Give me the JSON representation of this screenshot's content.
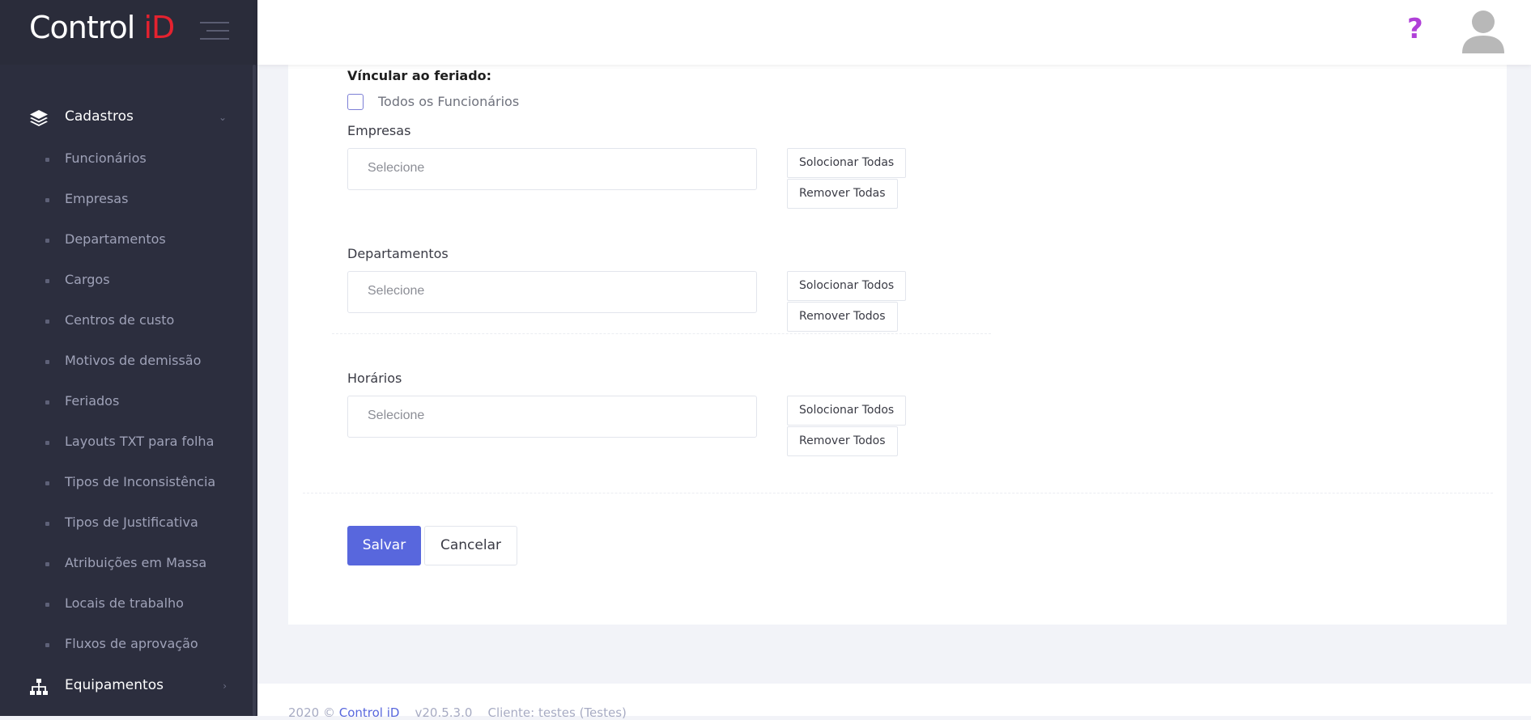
{
  "logo": {
    "main": "Control ",
    "accent": "iD"
  },
  "sidebar": {
    "sections": [
      {
        "label": "Cadastros",
        "icon": "layers-icon"
      },
      {
        "label": "Equipamentos",
        "icon": "sitemap-icon"
      }
    ],
    "items": [
      "Funcionários",
      "Empresas",
      "Departamentos",
      "Cargos",
      "Centros de custo",
      "Motivos de demissão",
      "Feriados",
      "Layouts TXT para folha",
      "Tipos de Inconsistência",
      "Tipos de Justificativa",
      "Atribuições em Massa",
      "Locais de trabalho",
      "Fluxos de aprovação"
    ]
  },
  "header": {
    "help": "?"
  },
  "form": {
    "title": "Víncular ao feriado:",
    "all_employees_label": "Todos os Funcionários",
    "empresas": {
      "label": "Empresas",
      "placeholder": "Selecione",
      "select_all": "Solocionar Todas",
      "remove_all": "Remover Todas"
    },
    "departamentos": {
      "label": "Departamentos",
      "placeholder": "Selecione",
      "select_all": "Solocionar Todos",
      "remove_all": "Remover Todos"
    },
    "horarios": {
      "label": "Horários",
      "placeholder": "Selecione",
      "select_all": "Solocionar Todos",
      "remove_all": "Remover Todos"
    },
    "save_label": "Salvar",
    "cancel_label": "Cancelar"
  },
  "footer": {
    "prefix": "2020 © ",
    "brand": "Control iD",
    "version": "v20.5.3.0",
    "client": "Cliente: testes (Testes)"
  },
  "colors": {
    "sidebar_bg": "#2c2e3e",
    "accent": "#5867dd",
    "logo_red": "#e4222f",
    "help": "#b040d8"
  }
}
